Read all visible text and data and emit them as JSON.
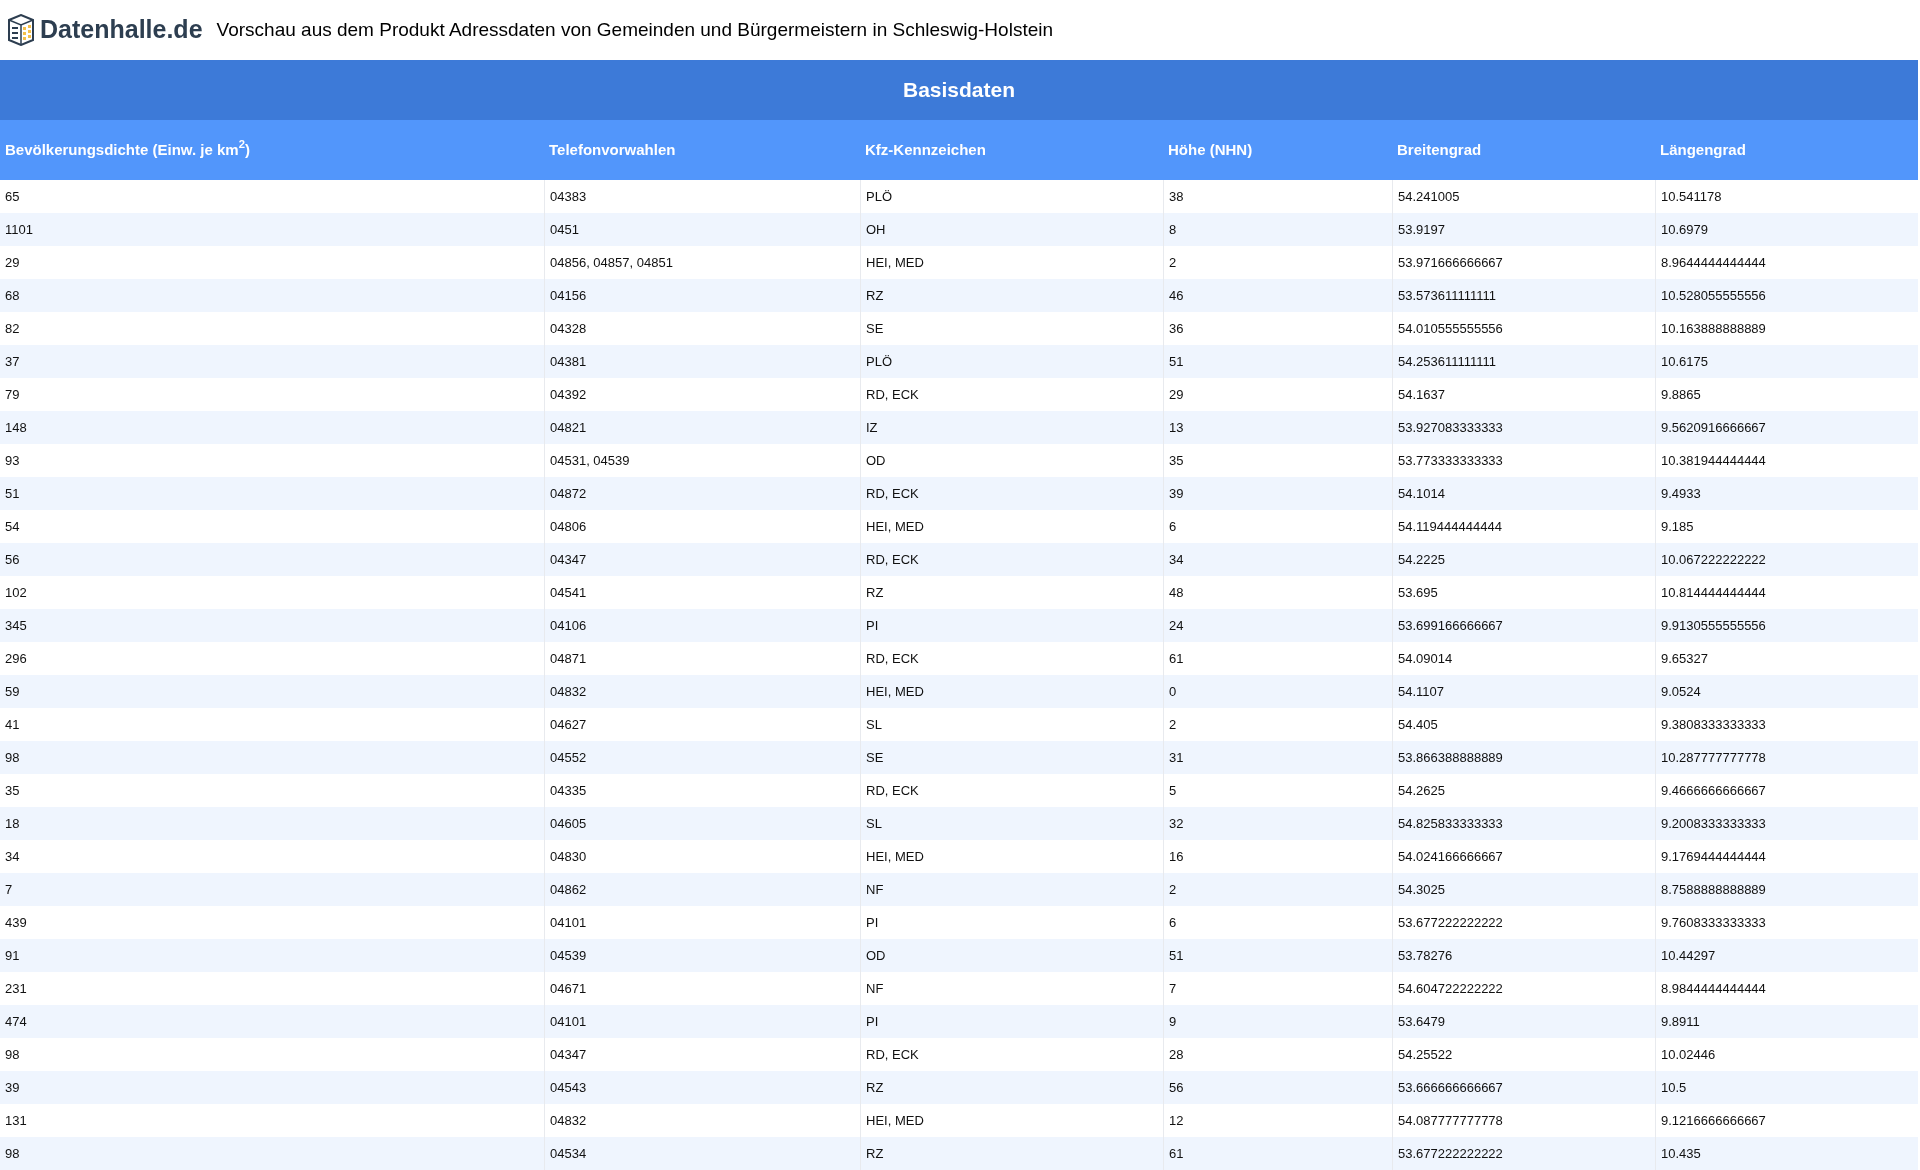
{
  "header": {
    "logo_text": "Datenhalle.de",
    "title": "Vorschau aus dem Produkt Adressdaten von Gemeinden und Bürgermeistern in Schleswig-Holstein"
  },
  "table": {
    "caption": "Basisdaten",
    "columns": [
      "Bevölkerungsdichte (Einw. je km$^{2}$)",
      "Telefonvorwahlen",
      "Kfz-Kennzeichen",
      "Höhe (NHN)",
      "Breitengrad",
      "Längengrad"
    ],
    "rows": [
      [
        "65",
        "04383",
        "PLÖ",
        "38",
        "54.241005",
        "10.541178"
      ],
      [
        "1101",
        "0451",
        "OH",
        "8",
        "53.9197",
        "10.6979"
      ],
      [
        "29",
        "04856, 04857, 04851",
        "HEI, MED",
        "2",
        "53.971666666667",
        "8.9644444444444"
      ],
      [
        "68",
        "04156",
        "RZ",
        "46",
        "53.573611111111",
        "10.528055555556"
      ],
      [
        "82",
        "04328",
        "SE",
        "36",
        "54.010555555556",
        "10.163888888889"
      ],
      [
        "37",
        "04381",
        "PLÖ",
        "51",
        "54.253611111111",
        "10.6175"
      ],
      [
        "79",
        "04392",
        "RD, ECK",
        "29",
        "54.1637",
        "9.8865"
      ],
      [
        "148",
        "04821",
        "IZ",
        "13",
        "53.927083333333",
        "9.5620916666667"
      ],
      [
        "93",
        "04531, 04539",
        "OD",
        "35",
        "53.773333333333",
        "10.381944444444"
      ],
      [
        "51",
        "04872",
        "RD, ECK",
        "39",
        "54.1014",
        "9.4933"
      ],
      [
        "54",
        "04806",
        "HEI, MED",
        "6",
        "54.119444444444",
        "9.185"
      ],
      [
        "56",
        "04347",
        "RD, ECK",
        "34",
        "54.2225",
        "10.067222222222"
      ],
      [
        "102",
        "04541",
        "RZ",
        "48",
        "53.695",
        "10.814444444444"
      ],
      [
        "345",
        "04106",
        "PI",
        "24",
        "53.699166666667",
        "9.9130555555556"
      ],
      [
        "296",
        "04871",
        "RD, ECK",
        "61",
        "54.09014",
        "9.65327"
      ],
      [
        "59",
        "04832",
        "HEI, MED",
        "0",
        "54.1107",
        "9.0524"
      ],
      [
        "41",
        "04627",
        "SL",
        "2",
        "54.405",
        "9.3808333333333"
      ],
      [
        "98",
        "04552",
        "SE",
        "31",
        "53.866388888889",
        "10.287777777778"
      ],
      [
        "35",
        "04335",
        "RD, ECK",
        "5",
        "54.2625",
        "9.4666666666667"
      ],
      [
        "18",
        "04605",
        "SL",
        "32",
        "54.825833333333",
        "9.2008333333333"
      ],
      [
        "34",
        "04830",
        "HEI, MED",
        "16",
        "54.024166666667",
        "9.1769444444444"
      ],
      [
        "7",
        "04862",
        "NF",
        "2",
        "54.3025",
        "8.7588888888889"
      ],
      [
        "439",
        "04101",
        "PI",
        "6",
        "53.677222222222",
        "9.7608333333333"
      ],
      [
        "91",
        "04539",
        "OD",
        "51",
        "53.78276",
        "10.44297"
      ],
      [
        "231",
        "04671",
        "NF",
        "7",
        "54.604722222222",
        "8.9844444444444"
      ],
      [
        "474",
        "04101",
        "PI",
        "9",
        "53.6479",
        "9.8911"
      ],
      [
        "98",
        "04347",
        "RD, ECK",
        "28",
        "54.25522",
        "10.02446"
      ],
      [
        "39",
        "04543",
        "RZ",
        "56",
        "53.666666666667",
        "10.5"
      ],
      [
        "131",
        "04832",
        "HEI, MED",
        "12",
        "54.087777777778",
        "9.1216666666667"
      ],
      [
        "98",
        "04534",
        "RZ",
        "61",
        "53.677222222222",
        "10.435"
      ]
    ]
  }
}
